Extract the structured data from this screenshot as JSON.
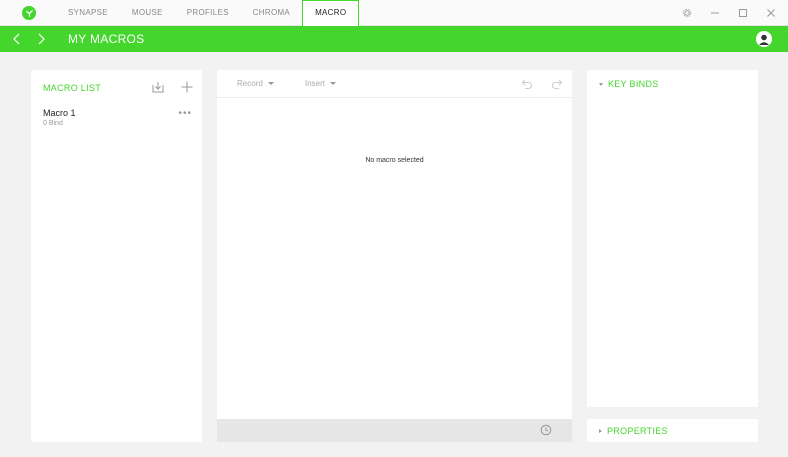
{
  "tabs": [
    {
      "label": "SYNAPSE"
    },
    {
      "label": "MOUSE"
    },
    {
      "label": "PROFILES"
    },
    {
      "label": "CHROMA"
    },
    {
      "label": "MACRO",
      "active": true
    }
  ],
  "header": {
    "title": "MY MACROS"
  },
  "macro_list": {
    "title": "MACRO LIST",
    "items": [
      {
        "name": "Macro 1",
        "sub": "0 Bind",
        "more": "•••"
      }
    ]
  },
  "editor": {
    "record_label": "Record",
    "insert_label": "Insert",
    "empty_message": "No macro selected"
  },
  "keybinds": {
    "title": "KEY BINDS"
  },
  "properties": {
    "title": "PROPERTIES"
  },
  "colors": {
    "accent": "#44d62c",
    "background": "#f2f2f2",
    "panel": "#ffffff"
  },
  "icons": [
    "razer-logo-icon",
    "settings-icon",
    "minimize-icon",
    "maximize-icon",
    "close-icon",
    "back-arrow-icon",
    "forward-arrow-icon",
    "user-avatar-icon",
    "import-icon",
    "add-icon",
    "undo-icon",
    "redo-icon",
    "clock-icon"
  ]
}
